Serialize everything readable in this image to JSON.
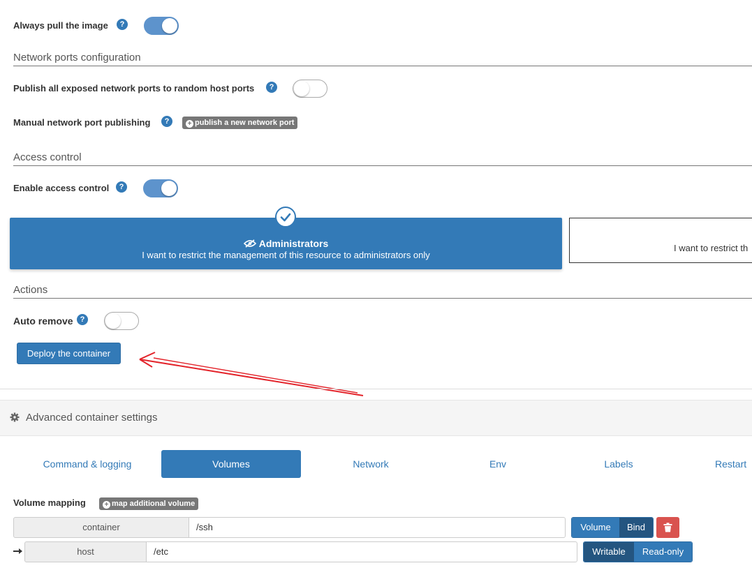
{
  "pull": {
    "label": "Always pull the image",
    "help": "?",
    "enabled": true
  },
  "network": {
    "title": "Network ports configuration",
    "publish_all_label": "Publish all exposed network ports to random host ports",
    "publish_all_enabled": false,
    "manual_label": "Manual network port publishing",
    "publish_button": "publish a new network port"
  },
  "access": {
    "title": "Access control",
    "enable_label": "Enable access control",
    "enabled": true,
    "admin_card": {
      "title": "Administrators",
      "description": "I want to restrict the management of this resource to administrators only"
    },
    "restricted_card": {
      "description": "I want to restrict th"
    }
  },
  "actions": {
    "title": "Actions",
    "auto_remove_label": "Auto remove",
    "auto_remove_enabled": false,
    "deploy_button": "Deploy the container"
  },
  "advanced": {
    "title": "Advanced container settings",
    "tabs": [
      "Command & logging",
      "Volumes",
      "Network",
      "Env",
      "Labels",
      "Restart"
    ],
    "active_tab": "Volumes",
    "volume_mapping_label": "Volume mapping",
    "map_button": "map additional volume",
    "container": {
      "label": "container",
      "value": "/ssh"
    },
    "host": {
      "label": "host",
      "value": "/etc"
    },
    "type_options": [
      "Volume",
      "Bind"
    ],
    "selected_type": "Bind",
    "access_options": [
      "Writable",
      "Read-only"
    ],
    "selected_access": "Writable"
  },
  "colors": {
    "primary": "#337ab7",
    "danger": "#d9534f",
    "annotation_arrow": "#e3242b"
  }
}
